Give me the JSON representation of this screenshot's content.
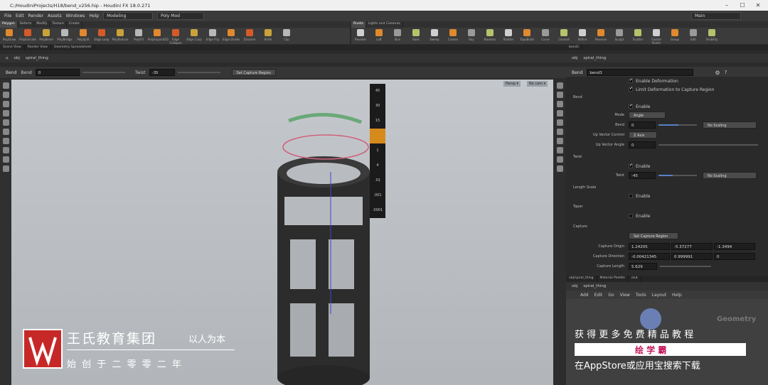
{
  "title": "C:/HoudiniProjects/H18/bend_v256.hip - Houdini FX 18.0.271",
  "menu": [
    "File",
    "Edit",
    "Render",
    "Assets",
    "Windows",
    "Help"
  ],
  "desktop": "Modeling",
  "shelfset": "Poly Mod",
  "user": "Main",
  "shelf_tabs": [
    "Polygon",
    "Deform",
    "Modify",
    "Texture",
    "Create"
  ],
  "shelf_tools": [
    "PolyDraw",
    "PolyExtrude",
    "PolyBevel",
    "PolyBridge",
    "PolySplit",
    "Edge Loop",
    "PolyReduce",
    "PolyFill",
    "PolyExpand2D",
    "Edge Collapse",
    "Edge Cusp",
    "Edge Flip",
    "Edge Divide",
    "Dissolve",
    "Knife",
    "Clip"
  ],
  "shelf2_tabs": [
    "Rivets",
    "Lights and Cameras"
  ],
  "shelf2_tools": [
    "Revolve",
    "Loft",
    "Skin",
    "Rails",
    "Sweep",
    "Crease",
    "Ray",
    "Boolean",
    "Shatter",
    "TopoBuild",
    "Curve",
    "Convert",
    "Refine",
    "Reverse",
    "Sculpt",
    "Scatter",
    "Cluster Points",
    "Group",
    "Edit",
    "Visibility"
  ],
  "pane_tabs": [
    "Scene View",
    "Render View",
    "Geometry Spreadsheet"
  ],
  "path": [
    "obj",
    "spiral_thing"
  ],
  "opbar": {
    "name": "Bend",
    "bend_label": "Bend",
    "bend_value": "0",
    "twist_label": "Twist",
    "twist_value": "-35",
    "capture_btn": "Set Capture Region"
  },
  "view_labels": [
    "Persp ▾",
    "No cam ▾"
  ],
  "ladder": [
    "45",
    "30",
    "15",
    "1",
    "4",
    ".01",
    ".001",
    ".0001"
  ],
  "param": {
    "tab": "bend1",
    "path": [
      "obj",
      "spiral_thing"
    ],
    "op": "Bend",
    "node": "bend3",
    "enable_deformation": "Enable Deformation",
    "limit": "Limit Deformation to Capture Region",
    "bend_sect": "Bend",
    "enable": "Enable",
    "mode_label": "Mode",
    "mode_value": "Angle",
    "bend_label": "Bend",
    "bend_value": "0",
    "no_scaling": "No Scaling",
    "upctl_label": "Up Vector Control",
    "upctl_value": "Z Axis",
    "upang_label": "Up Vector Angle",
    "upang_value": "0",
    "twist_sect": "Twist",
    "twist_label": "Twist",
    "twist_value": "-45",
    "length_sect": "Length Scale",
    "taper_sect": "Taper",
    "capture_sect": "Capture",
    "capture_btn": "Set Capture Region",
    "origin_label": "Capture Origin",
    "origin": [
      "1.24205",
      "-5.37277",
      "-1.3494"
    ],
    "dir_label": "Capture Direction",
    "dir": [
      "-0.00421345",
      "0.999991",
      "0"
    ],
    "len_label": "Capture Length",
    "len": "5.629"
  },
  "net": {
    "tabs": [
      "obj/spiral_thing",
      "Material Palette"
    ],
    "path": "/out",
    "path2": [
      "obj",
      "spiral_thing"
    ],
    "menu": [
      "Add",
      "Edit",
      "Go",
      "View",
      "Tools",
      "Layout",
      "Help"
    ],
    "geom": "Geometry"
  },
  "watermark": {
    "company": "王氏教育集团",
    "slogan": "以人为本",
    "founded": "始 创 于 二 零 零 二 年",
    "promo1": "获 得 更 多 免 费 精 品 教 程",
    "promo2": "绘 学 霸",
    "promo3": "在AppStore或应用宝搜索下载"
  }
}
